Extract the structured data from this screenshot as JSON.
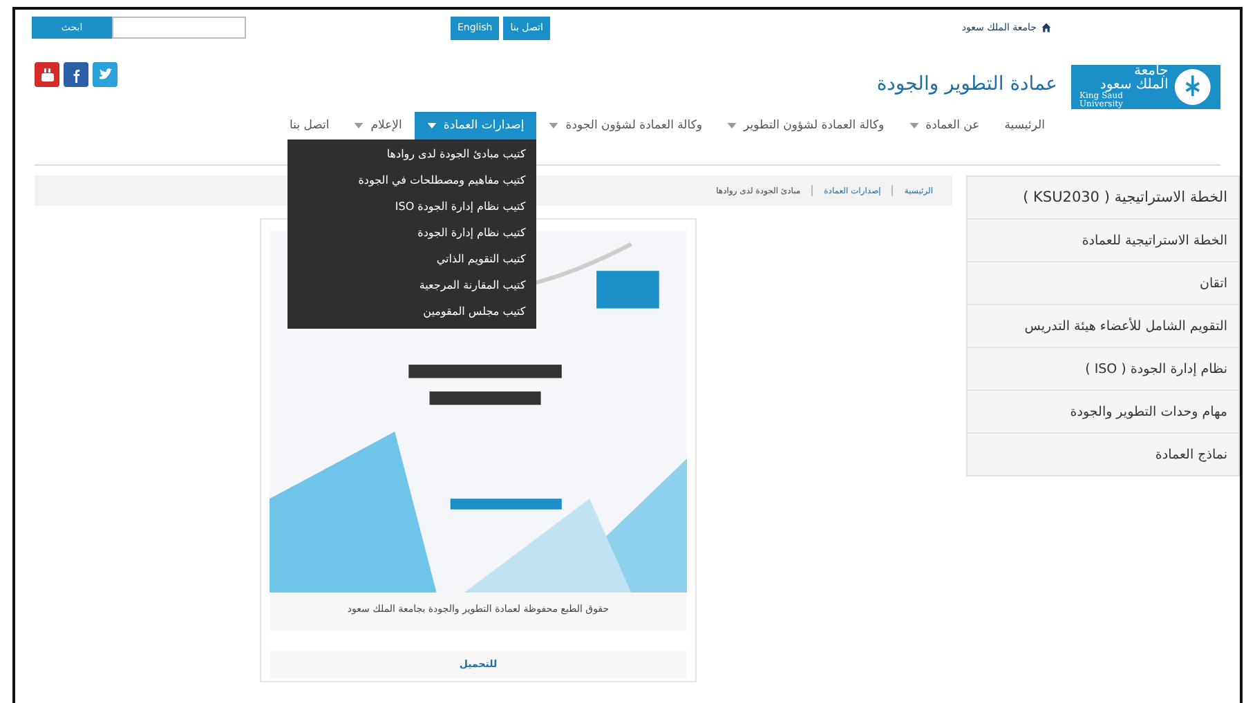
{
  "top_bar": {
    "search_button": "ابحث",
    "language_button": "English",
    "contact_button": "اتصل بنا",
    "home_link": "جامعة الملك سعود"
  },
  "header": {
    "logo": {
      "arabic_line1": "جامعة",
      "arabic_line2": "الملك سعود",
      "english": "King Saud University"
    },
    "title": "عمادة التطوير والجودة"
  },
  "nav": [
    {
      "label": "الرئيسية",
      "has_dropdown": false,
      "selected": false
    },
    {
      "label": "عن العمادة",
      "has_dropdown": true,
      "selected": false
    },
    {
      "label": "وكالة العمادة لشؤون التطوير",
      "has_dropdown": true,
      "selected": false
    },
    {
      "label": "وكالة العمادة لشؤون الجودة",
      "has_dropdown": true,
      "selected": false
    },
    {
      "label": "إصدارات العمادة",
      "has_dropdown": true,
      "selected": true
    },
    {
      "label": "الإعلام",
      "has_dropdown": true,
      "selected": false
    },
    {
      "label": "اتصل بنا",
      "has_dropdown": false,
      "selected": false
    }
  ],
  "dropdown": [
    "كتيب مبادئ الجودة لدى روادها",
    "كتيب مفاهيم ومصطلحات في الجودة",
    "كتيب نظام إدارة الجودة ISO",
    "كتيب نظام إدارة الجودة",
    "كتيب التقويم الذاتي",
    "كتيب المقارنة المرجعية",
    "كتيب مجلس المقومين"
  ],
  "breadcrumb": [
    {
      "label": "الرئيسية",
      "kind": "link"
    },
    {
      "label": "إصدارات العمادة",
      "kind": "link"
    },
    {
      "label": "مبادئ الجودة لدى روادها",
      "kind": "current"
    }
  ],
  "sidebar": [
    "الخطة الاستراتيجية ( KSU2030 )",
    "الخطة الاستراتيجية للعمادة",
    "اتقان",
    "التقويم الشامل للأعضاء هيئة التدريس",
    "نظام إدارة الجودة ( ISO )",
    "مهام وحدات التطوير والجودة",
    "نماذج العمادة"
  ],
  "book": {
    "caption": "حقوق الطبع محفوظة لعمادة التطوير والجودة بجامعة الملك سعود",
    "download_link": "للتحميل"
  }
}
